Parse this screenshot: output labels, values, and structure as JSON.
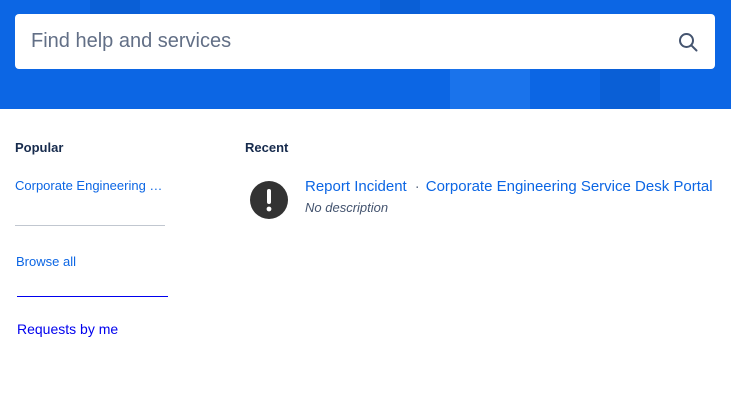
{
  "search": {
    "placeholder": "Find help and services"
  },
  "popular": {
    "heading": "Popular",
    "items": [
      {
        "label": "Corporate Engineering Service Desk Portal"
      }
    ],
    "browse_all": "Browse all",
    "requests_by_me": "Requests by me"
  },
  "recent": {
    "heading": "Recent",
    "items": [
      {
        "title": "Report Incident",
        "separator": "·",
        "service": "Corporate Engineering Service Desk Portal",
        "description": "No description",
        "icon": "exclamation-circle-icon"
      }
    ]
  },
  "colors": {
    "hero_bg": "#0c66e4",
    "link": "#0c66e4",
    "visited_link": "#0000ee",
    "heading": "#172b4d"
  }
}
